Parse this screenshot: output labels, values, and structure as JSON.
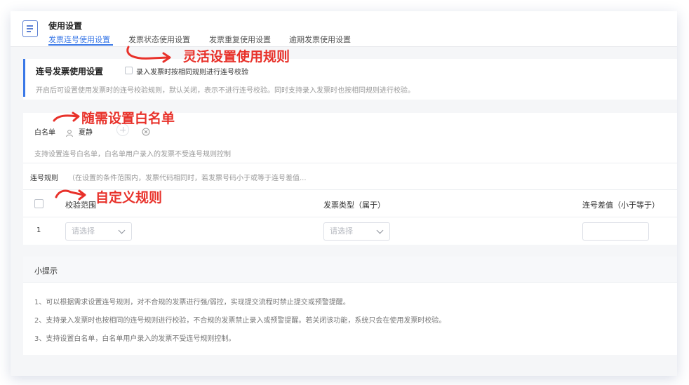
{
  "header": {
    "title": "使用设置",
    "tabs": [
      {
        "label": "发票连号使用设置",
        "active": true
      },
      {
        "label": "发票状态使用设置"
      },
      {
        "label": "发票重复使用设置"
      },
      {
        "label": "逾期发票使用设置"
      }
    ]
  },
  "serial_section": {
    "title": "连号发票使用设置",
    "checkbox_label": "录入发票时按相同规则进行连号校验",
    "checkbox_checked": false,
    "description": "开启后可设置使用发票时的连号校验规则，默认关闭，表示不进行连号校验。同时支持录入发票时也按相同规则进行校验。"
  },
  "whitelist": {
    "label": "白名单",
    "user": "夏静",
    "hint": "支持设置连号白名单，白名单用户录入的发票不受连号规则控制"
  },
  "rule": {
    "label": "连号规则",
    "desc": "（在设置的条件范围内，发票代码相同时，若发票号码小于或等于连号差值..."
  },
  "table": {
    "headers": [
      "校验范围",
      "发票类型（属于）",
      "连号差值（小于等于）"
    ],
    "rows": [
      {
        "index": "1",
        "scope_placeholder": "请选择",
        "type_placeholder": "请选择",
        "diff_value": ""
      }
    ]
  },
  "tips": {
    "title": "小提示",
    "items": [
      "1、可以根据需求设置连号规则，对不合规的发票进行强/弱控，实现提交流程时禁止提交或预警提醒。",
      "2、支持录入发票时也按相同的连号规则进行校验，不合规的发票禁止录入或预警提醒。若关闭该功能，系统只会在使用发票时校验。",
      "3、支持设置白名单，白名单用户录入的发票不受连号规则控制。"
    ]
  },
  "annotations": {
    "a1": "灵活设置使用规则",
    "a2": "随需设置白名单",
    "a3": "自定义规则"
  },
  "colors": {
    "accent": "#3a78e7",
    "annotation": "#e8312a"
  }
}
